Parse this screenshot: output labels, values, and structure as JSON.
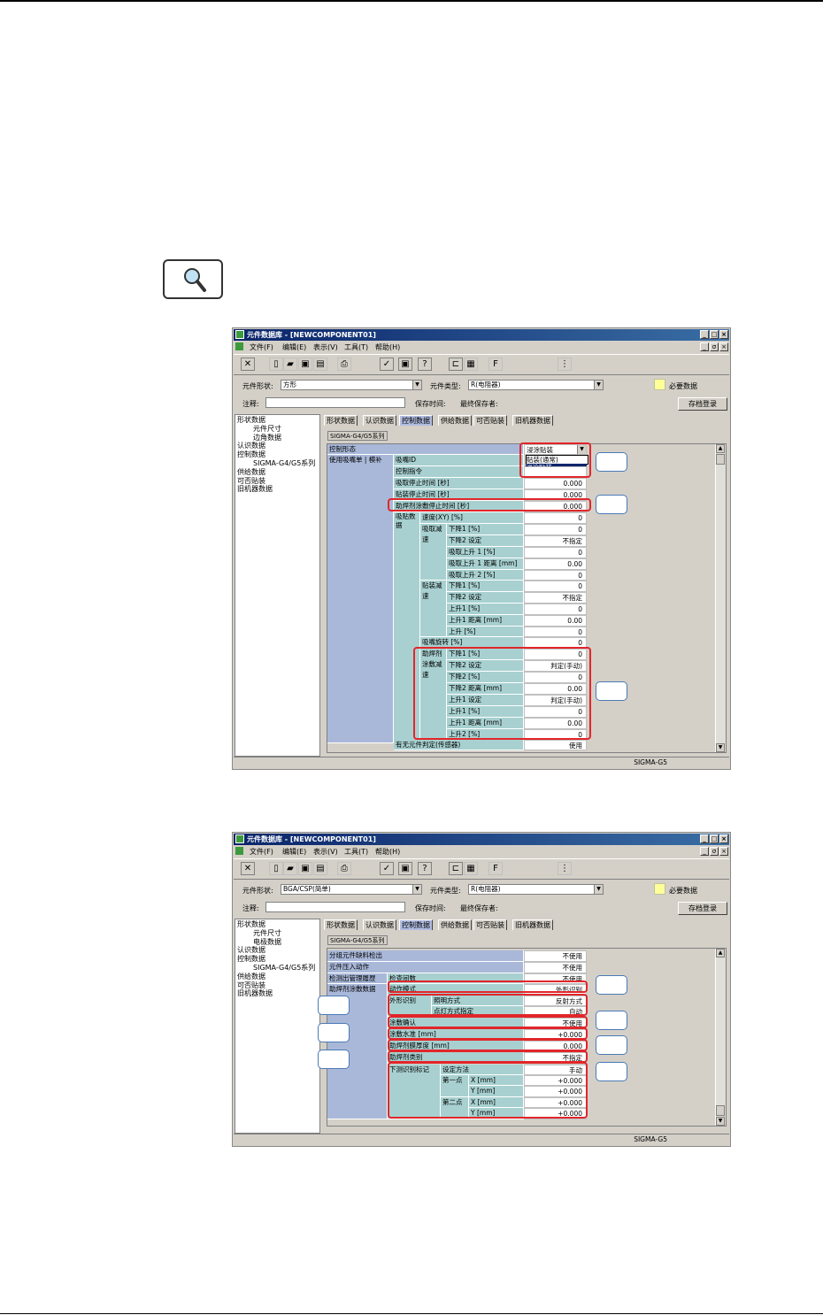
{
  "window_title": "元件数据库 - [NEWCOMPONENT01]",
  "menu": [
    "文件(F)",
    "编辑(E)",
    "表示(V)",
    "工具(T)",
    "帮助(H)"
  ],
  "title_buttons": [
    "_",
    "□",
    "×"
  ],
  "mdi_buttons": [
    "_",
    "σ",
    "×"
  ],
  "labels": {
    "shape": "元件形状:",
    "type": "元件类型:",
    "required": "必要数据",
    "note": "注释:",
    "save_time": "保存时间:",
    "last_saver": "最终保存者:",
    "store_button": "存档登录",
    "status": "SIGMA-G5"
  },
  "tabs": [
    "形状数据",
    "认识数据",
    "控制数据",
    "供给数据",
    "可否贴装",
    "旧机器数据"
  ],
  "subtab": "SIGMA-G4/G5系列",
  "screen1": {
    "shape_value": "方形",
    "type_value": "R(电阻器)",
    "tree": [
      "形状数据",
      "元件尺寸",
      "边角数据",
      "认识数据",
      "控制数据",
      "SIGMA-G4/G5系列",
      "供给数据",
      "可否贴装",
      "旧机器数据"
    ],
    "control_label": "控制形态",
    "control_value": "浸涂贴装",
    "dropdown": [
      "贴装(通常)",
      "浸涂贴装"
    ],
    "nozzle_label": "使用吸嘴单 | 模补",
    "nozzle_rows": [
      {
        "label": "吸嘴ID",
        "value": ""
      },
      {
        "label": "控制指令",
        "value": ""
      },
      {
        "label": "吸取停止时间 [秒]",
        "value": "0.000"
      },
      {
        "label": "贴装停止时间 [秒]",
        "value": "0.000"
      },
      {
        "label": "助焊剂涂敷停止时间 [秒]",
        "value": "0.000"
      }
    ],
    "speed_label": "吸贴数据",
    "xy_row": {
      "label": "速度(XY) [%]",
      "value": "0"
    },
    "pick_group": "吸取减速",
    "pick_rows": [
      {
        "label": "下降1 [%]",
        "value": "0"
      },
      {
        "label": "下降2 设定",
        "value": "不指定"
      },
      {
        "label": "吸取上升 1 [%]",
        "value": "0"
      },
      {
        "label": "吸取上升 1 距离 [mm]",
        "value": "0.00"
      },
      {
        "label": "吸取上升 2 [%]",
        "value": "0"
      }
    ],
    "mount_group": "贴装减速",
    "mount_rows": [
      {
        "label": "下降1 [%]",
        "value": "0"
      },
      {
        "label": "下降2 设定",
        "value": "不指定"
      },
      {
        "label": "上升1 [%]",
        "value": "0"
      },
      {
        "label": "上升1 距离 [mm]",
        "value": "0.00"
      },
      {
        "label": "上升 [%]",
        "value": "0"
      }
    ],
    "rotate_row": {
      "label": "吸嘴旋转 [%]",
      "value": "0"
    },
    "flux_group": "助焊剂涂敷减速",
    "flux_rows": [
      {
        "label": "下降1 [%]",
        "value": "0"
      },
      {
        "label": "下降2 设定",
        "value": "判定(手动)"
      },
      {
        "label": "下降2 [%]",
        "value": "0"
      },
      {
        "label": "下降2 距离 [mm]",
        "value": "0.00"
      },
      {
        "label": "上升1 设定",
        "value": "判定(手动)"
      },
      {
        "label": "上升1 [%]",
        "value": "0"
      },
      {
        "label": "上升1 距离 [mm]",
        "value": "0.00"
      },
      {
        "label": "上升2 [%]",
        "value": "0"
      }
    ],
    "last_row": {
      "label": "有无元件判定(传感器)",
      "value": "使用"
    }
  },
  "screen2": {
    "shape_value": "BGA/CSP(简单)",
    "type_value": "R(电阻器)",
    "tree": [
      "形状数据",
      "元件尺寸",
      "电极数据",
      "认识数据",
      "控制数据",
      "SIGMA-G4/G5系列",
      "供给数据",
      "可否贴装",
      "旧机器数据"
    ],
    "top_rows": [
      {
        "label": "分组元件缺料检出",
        "value": "不使用"
      },
      {
        "label": "元件压入动作",
        "value": "不使用"
      },
      {
        "label": "检测出管理履歴",
        "value": "不使用"
      }
    ],
    "flux_label": "助焊剂涂敷数据",
    "check_label": "检查间数",
    "mode_row": {
      "label": "动作模式",
      "value": "外形识别"
    },
    "shape_group": "外形识别",
    "shape_rows": [
      {
        "label": "照明方式",
        "value": "反射方式"
      },
      {
        "label": "点灯方式指定",
        "value": "自动"
      }
    ],
    "rows": [
      {
        "label": "涂敷确认",
        "value": "不使用"
      },
      {
        "label": "涂敷水准 [mm]",
        "value": "+0.000"
      },
      {
        "label": "助焊剂膜厚度 [mm]",
        "value": "0.000"
      },
      {
        "label": "助焊剂类别",
        "value": "不指定"
      }
    ],
    "offset_label": "下测识别标记",
    "offset_method": {
      "label": "设定方法",
      "value": "手动"
    },
    "point1": "第一点",
    "point2": "第二点",
    "point_rows": [
      {
        "label": "X [mm]",
        "value": "+0.000"
      },
      {
        "label": "Y [mm]",
        "value": "+0.000"
      },
      {
        "label": "X [mm]",
        "value": "+0.000"
      },
      {
        "label": "Y [mm]",
        "value": "+0.000"
      }
    ]
  },
  "colors": {
    "accent_red": "#e1262a",
    "callout_blue": "#4a7ab5",
    "grid_blue": "#a9b8d9",
    "grid_teal": "#a8d0d0",
    "titlebar": "#0a246a"
  }
}
